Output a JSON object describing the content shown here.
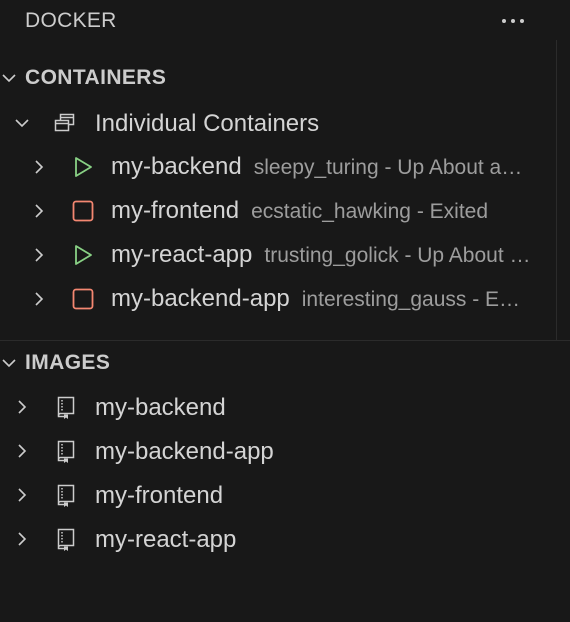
{
  "header": {
    "title": "DOCKER",
    "more_icon": "ellipsis-icon"
  },
  "containers": {
    "label": "CONTAINERS",
    "group": {
      "label": "Individual Containers",
      "icon": "stacked-windows-icon"
    },
    "items": [
      {
        "name": "my-backend",
        "detail": "sleepy_turing - Up About an hour",
        "status": "running",
        "icon": "play-icon"
      },
      {
        "name": "my-frontend",
        "detail": "ecstatic_hawking - Exited",
        "status": "stopped",
        "icon": "stop-icon"
      },
      {
        "name": "my-react-app",
        "detail": "trusting_golick - Up About an hour",
        "status": "running",
        "icon": "play-icon"
      },
      {
        "name": "my-backend-app",
        "detail": "interesting_gauss - Exited",
        "status": "stopped",
        "icon": "stop-icon"
      }
    ]
  },
  "images": {
    "label": "IMAGES",
    "items": [
      {
        "name": "my-backend",
        "icon": "image-book-icon"
      },
      {
        "name": "my-backend-app",
        "icon": "image-book-icon"
      },
      {
        "name": "my-frontend",
        "icon": "image-book-icon"
      },
      {
        "name": "my-react-app",
        "icon": "image-book-icon"
      }
    ]
  },
  "colors": {
    "background": "#181818",
    "text": "#d4d4d4",
    "muted": "#9d9d9d",
    "running": "#89d185",
    "stopped": "#f48771"
  }
}
